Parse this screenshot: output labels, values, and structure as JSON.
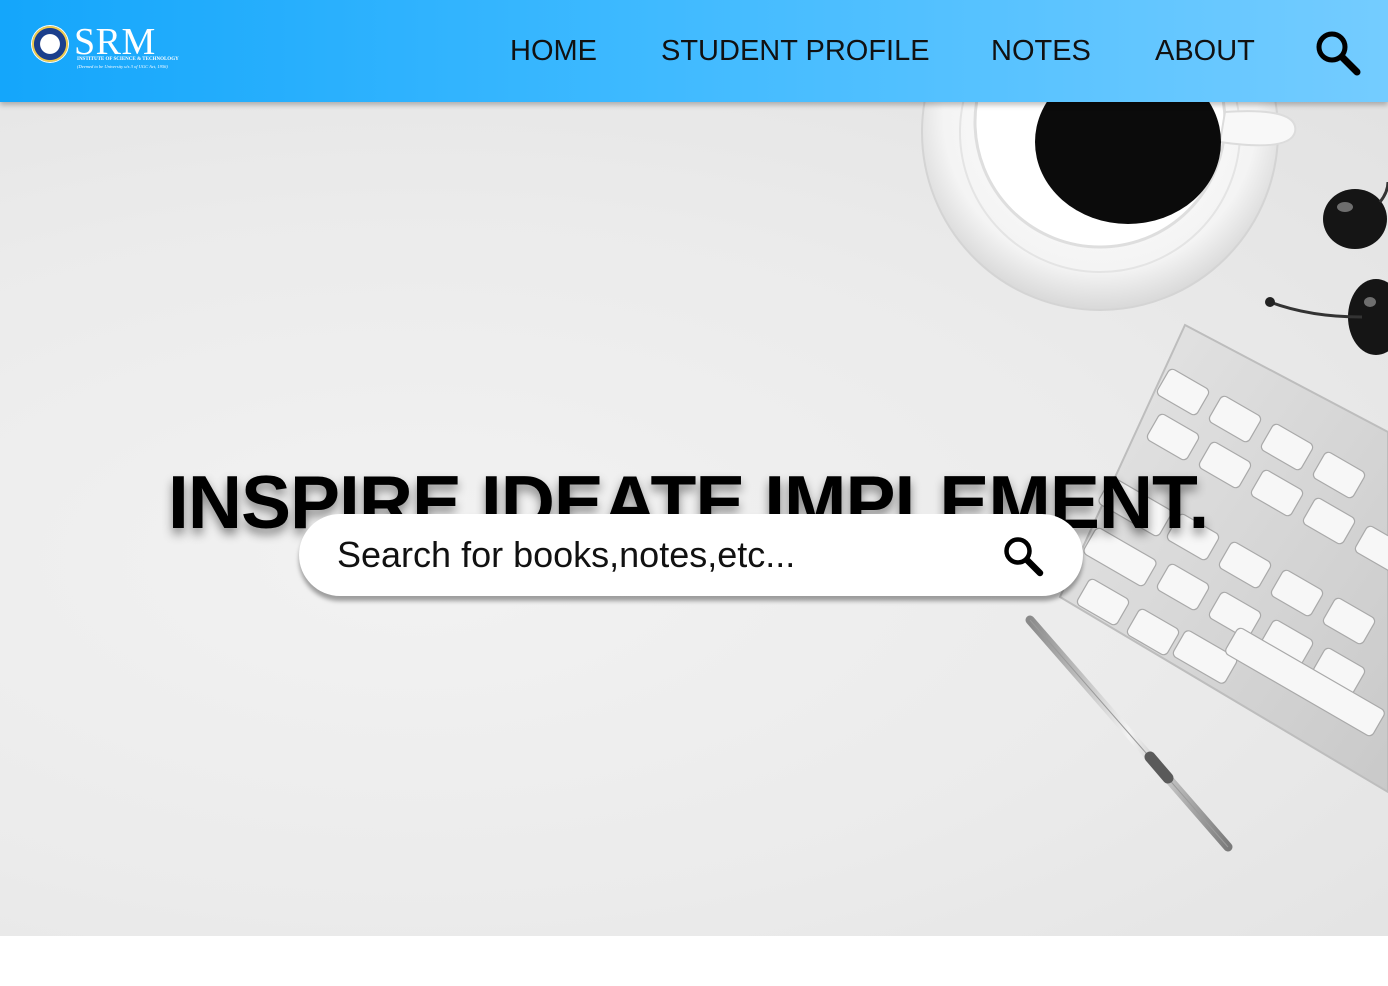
{
  "brand": {
    "name": "SRM",
    "subtitle_line1": "INSTITUTE OF SCIENCE & TECHNOLOGY",
    "subtitle_line2": "(Deemed to be University u/s 3 of UGC Act, 1956)",
    "nav_color": "#2fb3ff"
  },
  "nav": {
    "home": "HOME",
    "student_profile": "STUDENT PROFILE",
    "notes": "NOTES",
    "about": "ABOUT",
    "search_icon": "search-icon"
  },
  "hero": {
    "tagline": "INSPIRE.IDEATE.IMPLEMENT.",
    "search_placeholder": "Search for books,notes,etc...",
    "search_icon": "search-icon"
  }
}
